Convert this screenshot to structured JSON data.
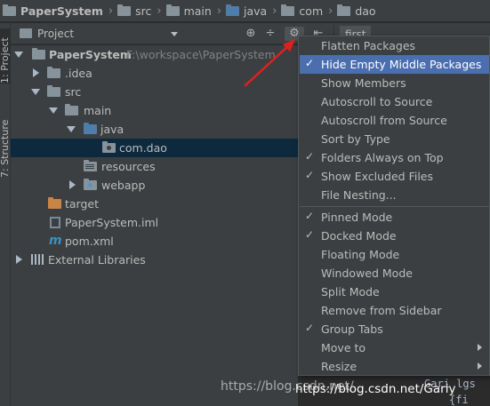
{
  "breadcrumb": [
    {
      "label": "PaperSystem",
      "icon": "project-folder-icon"
    },
    {
      "label": "src",
      "icon": "folder-icon"
    },
    {
      "label": "main",
      "icon": "folder-icon"
    },
    {
      "label": "java",
      "icon": "source-folder-icon"
    },
    {
      "label": "com",
      "icon": "folder-icon"
    },
    {
      "label": "dao",
      "icon": "folder-icon"
    }
  ],
  "left_strip": {
    "project_tab": "1: Project",
    "structure_tab": "7: Structure"
  },
  "project_panel": {
    "title": "Project",
    "editor_tab_label": "first"
  },
  "tree": [
    {
      "label": "PaperSystem",
      "path": "F:\\workspace\\PaperSystem"
    },
    {
      "label": ".idea"
    },
    {
      "label": "src"
    },
    {
      "label": "main"
    },
    {
      "label": "java"
    },
    {
      "label": "com.dao"
    },
    {
      "label": "resources"
    },
    {
      "label": "webapp"
    },
    {
      "label": "target"
    },
    {
      "label": "PaperSystem.iml"
    },
    {
      "label": "pom.xml"
    },
    {
      "label": "External Libraries"
    }
  ],
  "menu": {
    "items": [
      {
        "label": "Flatten Packages",
        "checked": false
      },
      {
        "label": "Hide Empty Middle Packages",
        "checked": true,
        "highlighted": true
      },
      {
        "label": "Show Members",
        "checked": false
      },
      {
        "label": "Autoscroll to Source",
        "checked": false
      },
      {
        "label": "Autoscroll from Source",
        "checked": false
      },
      {
        "label": "Sort by Type",
        "checked": false
      },
      {
        "label": "Folders Always on Top",
        "checked": true
      },
      {
        "label": "Show Excluded Files",
        "checked": true
      },
      {
        "label": "File Nesting...",
        "checked": false
      },
      {
        "label": "Pinned Mode",
        "checked": true
      },
      {
        "label": "Docked Mode",
        "checked": true
      },
      {
        "label": "Floating Mode",
        "checked": false
      },
      {
        "label": "Windowed Mode",
        "checked": false
      },
      {
        "label": "Split Mode",
        "checked": false
      },
      {
        "label": "Remove from Sidebar",
        "checked": false
      },
      {
        "label": "Group Tabs",
        "checked": true
      },
      {
        "label": "Move to",
        "submenu": true
      },
      {
        "label": "Resize",
        "submenu": true
      }
    ]
  },
  "editor_fragments": {
    "line1": "Gari lgs",
    "line2": "{fi"
  },
  "watermark": "https://blog.csdn.net/",
  "watermark_overlay": "https://blog.csdn.net/Gariy",
  "colors": {
    "highlight": "#4b6eaf",
    "selection": "#0d293e",
    "arrow": "#e02020"
  }
}
